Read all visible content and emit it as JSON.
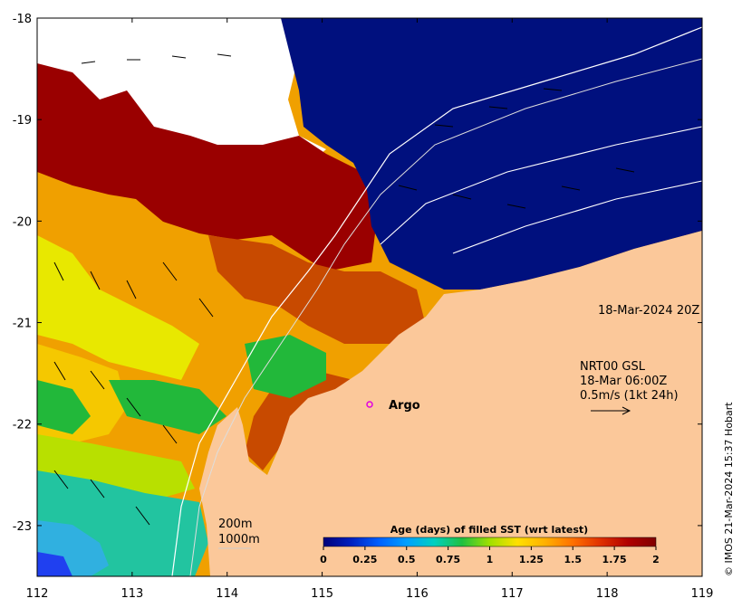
{
  "map": {
    "x_ticks": [
      "112",
      "113",
      "114",
      "115",
      "116",
      "117",
      "118",
      "119"
    ],
    "y_ticks": [
      "-18",
      "-19",
      "-20",
      "-21",
      "-22",
      "-23"
    ],
    "lon_range": [
      112,
      119
    ],
    "lat_range": [
      -23.5,
      -18
    ],
    "colors": {
      "land": "#fbc89a",
      "deep_blue": "#00107e",
      "dark_red": "#9a0000",
      "red_brown": "#c84a00",
      "orange": "#f0a000",
      "yellow_orange": "#f5c800",
      "yellow": "#e8e800",
      "yellow_green": "#b8e000",
      "green": "#22b83a",
      "teal": "#22c4a0",
      "cyan": "#30b0e0",
      "blue": "#2040f0",
      "white": "#ffffff"
    }
  },
  "annotations": {
    "timestamp": "18-Mar-2024 20Z",
    "current_source": "NRT00 GSL",
    "current_time": "18-Mar 06:00Z",
    "current_scale": "0.5m/s (1kt 24h)",
    "argo_label": "Argo",
    "isobath_200": "200m",
    "isobath_1000": "1000m",
    "credit": "© IMOS 21-Mar-2024 15:37 Hobart"
  },
  "colorbar": {
    "title": "Age (days) of filled SST (wrt latest)",
    "ticks": [
      "0",
      "0.25",
      "0.5",
      "0.75",
      "1",
      "1.25",
      "1.5",
      "1.75",
      "2"
    ],
    "range": [
      0,
      2
    ],
    "stops": [
      "#00007a",
      "#0020c0",
      "#0060ff",
      "#00a0ff",
      "#00d0c0",
      "#20c040",
      "#a0e000",
      "#ffe000",
      "#ffb000",
      "#ff7000",
      "#e03000",
      "#b00000",
      "#800000"
    ]
  }
}
